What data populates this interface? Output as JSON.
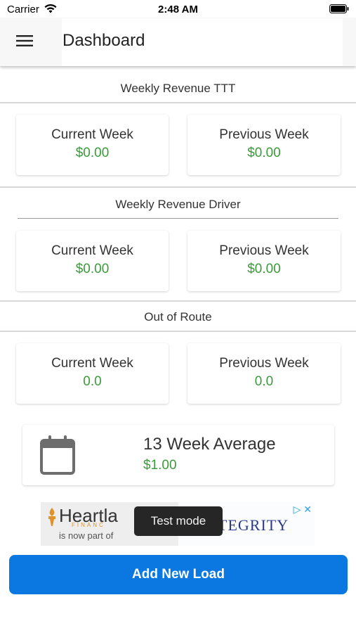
{
  "status_bar": {
    "carrier": "Carrier",
    "time": "2:48 AM"
  },
  "app_bar": {
    "title": "Dashboard"
  },
  "sections": [
    {
      "title": "Weekly Revenue TTT",
      "current": {
        "label": "Current Week",
        "value": "$0.00"
      },
      "previous": {
        "label": "Previous Week",
        "value": "$0.00"
      }
    },
    {
      "title": "Weekly Revenue Driver",
      "current": {
        "label": "Current Week",
        "value": "$0.00"
      },
      "previous": {
        "label": "Previous Week",
        "value": "$0.00"
      }
    },
    {
      "title": "Out of Route",
      "current": {
        "label": "Current Week",
        "value": "0.0"
      },
      "previous": {
        "label": "Previous Week",
        "value": "0.0"
      }
    }
  ],
  "average": {
    "label": "13 Week Average",
    "value": "$1.00"
  },
  "ad": {
    "brand_text": "Heartla",
    "brand_sub": "FINANC",
    "tagline": "is now part of",
    "partner": "TEGRITY",
    "toast": "Test mode"
  },
  "actions": {
    "add_load": "Add New Load"
  },
  "colors": {
    "accent": "#0a78e0",
    "value_green": "#3a9b3a"
  }
}
